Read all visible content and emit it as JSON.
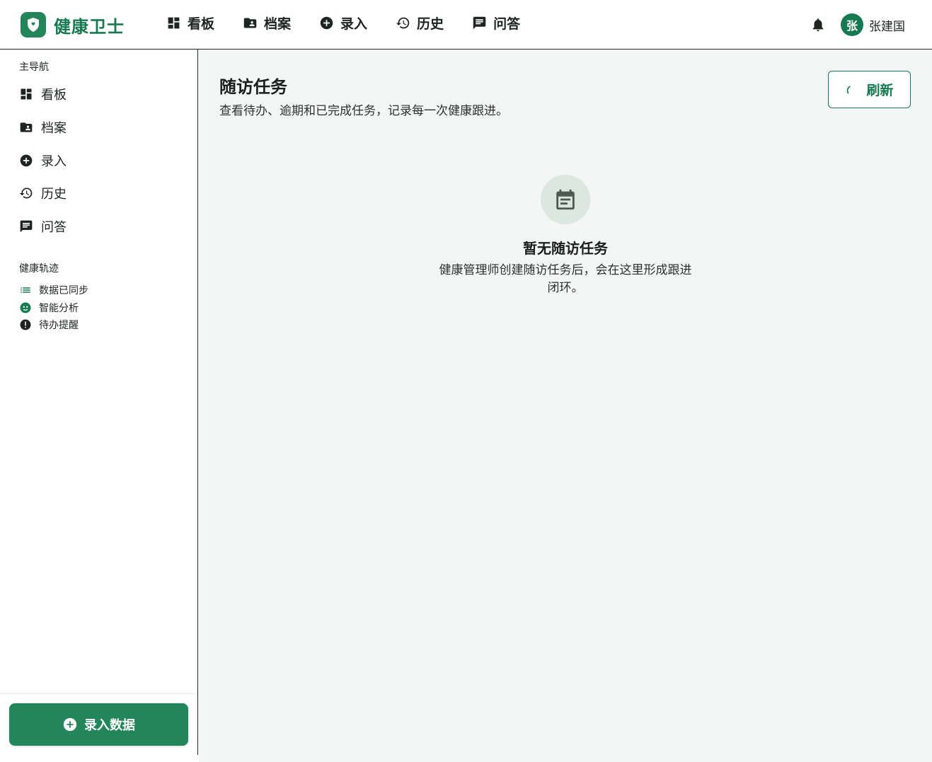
{
  "brand": {
    "name": "健康卫士",
    "logo_icon": "shield-heart-icon",
    "color": "#17794f"
  },
  "topnav": {
    "items": [
      {
        "label": "看板",
        "icon": "dashboard-icon"
      },
      {
        "label": "档案",
        "icon": "folder-user-icon"
      },
      {
        "label": "录入",
        "icon": "add-circle-icon"
      },
      {
        "label": "历史",
        "icon": "history-icon"
      },
      {
        "label": "问答",
        "icon": "chat-icon"
      }
    ]
  },
  "user": {
    "avatar_letter": "张",
    "name": "张建国",
    "notification_icon": "bell-icon"
  },
  "sidebar": {
    "main_section_title": "主导航",
    "items": [
      {
        "label": "看板",
        "icon": "dashboard-icon"
      },
      {
        "label": "档案",
        "icon": "folder-user-icon"
      },
      {
        "label": "录入",
        "icon": "add-circle-icon"
      },
      {
        "label": "历史",
        "icon": "history-icon"
      },
      {
        "label": "问答",
        "icon": "chat-icon"
      }
    ],
    "track_section_title": "健康轨迹",
    "track_items": [
      {
        "label": "数据已同步",
        "icon": "list-icon"
      },
      {
        "label": "智能分析",
        "icon": "smart-analysis-icon"
      },
      {
        "label": "待办提醒",
        "icon": "alert-icon"
      }
    ],
    "cta_label": "录入数据"
  },
  "main": {
    "title": "随访任务",
    "subtitle": "查看待办、逾期和已完成任务，记录每一次健康跟进。",
    "refresh_label": "刷新",
    "empty_title": "暂无随访任务",
    "empty_desc": "健康管理师创建随访任务后，会在这里形成跟进闭环。"
  },
  "colors": {
    "accent": "#22865a",
    "accent_dark": "#17794f",
    "main_bg": "#f4f6f5",
    "text": "#1a1f1c"
  }
}
